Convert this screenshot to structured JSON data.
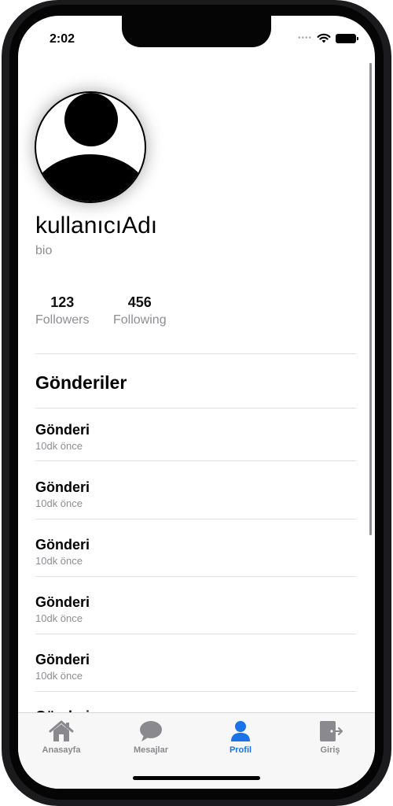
{
  "status_bar": {
    "time": "2:02"
  },
  "profile": {
    "username": "kullanıcıAdı",
    "bio": "bio",
    "stats": [
      {
        "value": "123",
        "label": "Followers"
      },
      {
        "value": "456",
        "label": "Following"
      }
    ]
  },
  "posts_section": {
    "title": "Gönderiler",
    "posts": [
      {
        "title": "Gönderi",
        "time": "10dk önce"
      },
      {
        "title": "Gönderi",
        "time": "10dk önce"
      },
      {
        "title": "Gönderi",
        "time": "10dk önce"
      },
      {
        "title": "Gönderi",
        "time": "10dk önce"
      },
      {
        "title": "Gönderi",
        "time": "10dk önce"
      }
    ]
  },
  "tab_bar": {
    "active_color": "#1a73e8",
    "inactive_color": "#8a8a8e",
    "tabs": [
      {
        "label": "Anasayfa",
        "icon": "home-icon",
        "active": false
      },
      {
        "label": "Mesajlar",
        "icon": "chat-bubble-icon",
        "active": false
      },
      {
        "label": "Profil",
        "icon": "person-icon",
        "active": true
      },
      {
        "label": "Giriş",
        "icon": "logout-icon",
        "active": false
      }
    ]
  }
}
